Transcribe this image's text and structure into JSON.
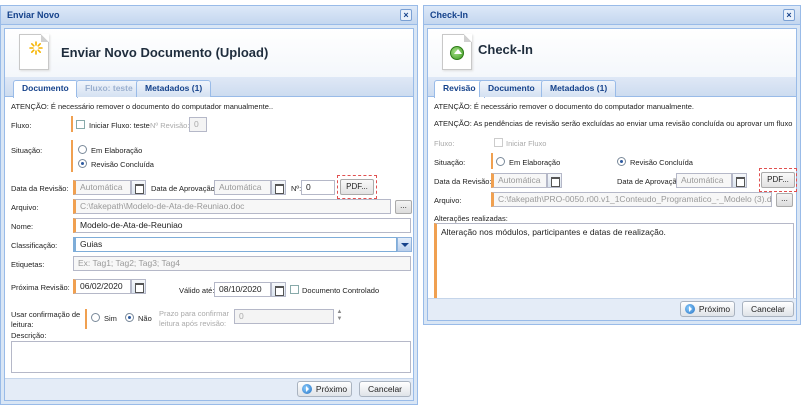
{
  "left": {
    "title": "Enviar Novo",
    "close": "×",
    "header_title": "Enviar Novo Documento (Upload)",
    "tabs": [
      "Documento",
      "Fluxo: teste",
      "Metadados (1)"
    ],
    "warning": "ATENÇÃO: É necessário remover o documento do computador manualmente..",
    "fluxo_label": "Fluxo:",
    "iniciar_fluxo": "Iniciar Fluxo: teste",
    "n_revisao_label": "Nº Revisão:",
    "n_revisao_value": "0",
    "situacao_label": "Situação:",
    "em_elaboracao": "Em Elaboração",
    "revisao_concluida": "Revisão Concluída",
    "data_revisao_label": "Data da Revisão:",
    "data_revisao_value": "Automática",
    "data_aprovacao_label": "Data de Aprovação:",
    "data_aprovacao_value": "Automática",
    "n_label": "Nº:",
    "n_value": "0",
    "pdf_button": "PDF...",
    "arquivo_label": "Arquivo:",
    "arquivo_value": "C:\\fakepath\\Modelo-de-Ata-de-Reuniao.doc",
    "browse_button": "...",
    "nome_label": "Nome:",
    "nome_value": "Modelo-de-Ata-de-Reuniao",
    "classificacao_label": "Classificação:",
    "classificacao_value": "Guias",
    "etiquetas_label": "Etiquetas:",
    "etiquetas_placeholder": "Ex: Tag1; Tag2; Tag3; Tag4",
    "proxima_revisao_label": "Próxima Revisão:",
    "proxima_revisao_value": "06/02/2020",
    "valido_ate_label": "Válido até:",
    "valido_ate_value": "08/10/2020",
    "documento_controlado": "Documento Controlado",
    "confirmacao_label_1": "Usar confirmação de",
    "confirmacao_label_2": "leitura:",
    "sim": "Sim",
    "nao": "Não",
    "prazo_label_1": "Prazo para confirmar",
    "prazo_label_2": "leitura após revisão:",
    "prazo_value": "0",
    "descricao_label": "Descrição:",
    "proximo_button": "Próximo",
    "cancelar_button": "Cancelar"
  },
  "right": {
    "title": "Check-In",
    "close": "×",
    "header_title": "Check-In",
    "tabs": [
      "Revisão",
      "Documento",
      "Metadados (1)"
    ],
    "warning_1": "ATENÇÃO: É necessário remover o documento do computador manualmente.",
    "warning_2": "ATENÇÃO: As pendências de revisão serão excluídas ao enviar uma revisão concluída ou aprovar um fluxo",
    "fluxo_label": "Fluxo:",
    "iniciar_fluxo": "Iniciar Fluxo",
    "situacao_label": "Situação:",
    "em_elaboracao": "Em Elaboração",
    "revisao_concluida": "Revisão Concluída",
    "data_revisao_label": "Data da Revisão:",
    "data_revisao_value": "Automática",
    "data_aprovacao_label": "Data de Aprovação:",
    "data_aprovacao_value": "Automática",
    "pdf_button": "PDF...",
    "arquivo_label": "Arquivo:",
    "arquivo_value": "C:\\fakepath\\PRO-0050.r00.v1_1Conteudo_Programatico_-_Modelo (3).d",
    "browse_button": "...",
    "alteracoes_label": "Alterações realizadas:",
    "alteracoes_value": "Alteração nos módulos, participantes e datas de realização.",
    "proximo_button": "Próximo",
    "cancelar_button": "Cancelar"
  }
}
